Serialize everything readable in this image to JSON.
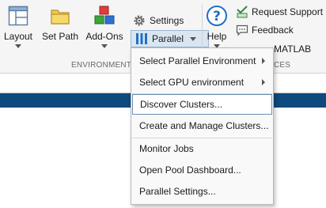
{
  "toolstrip": {
    "layout_label": "Layout",
    "set_path_label": "Set Path",
    "addons_label": "Add-Ons",
    "settings_label": "Settings",
    "parallel_label": "Parallel",
    "help_label": "Help",
    "request_support_label": "Request Support",
    "feedback_label": "Feedback",
    "learn_matlab_partial": "MATLAB",
    "environment_section_label": "ENVIRONMENT",
    "resources_section_partial": "CES"
  },
  "parallel_menu": {
    "items": [
      {
        "label": "Select Parallel Environment",
        "submenu": true
      },
      {
        "label": "Select GPU environment",
        "submenu": true
      },
      {
        "label": "Discover Clusters...",
        "submenu": false
      },
      {
        "label": "Create and Manage Clusters...",
        "submenu": false
      },
      {
        "label": "Monitor Jobs",
        "submenu": false
      },
      {
        "label": "Open Pool Dashboard...",
        "submenu": false
      },
      {
        "label": "Parallel Settings...",
        "submenu": false
      }
    ]
  },
  "colors": {
    "accent_band": "#0e4a7e",
    "parallel_button_bg": "#d9e6f2",
    "help_icon": "#1f6fc5"
  }
}
